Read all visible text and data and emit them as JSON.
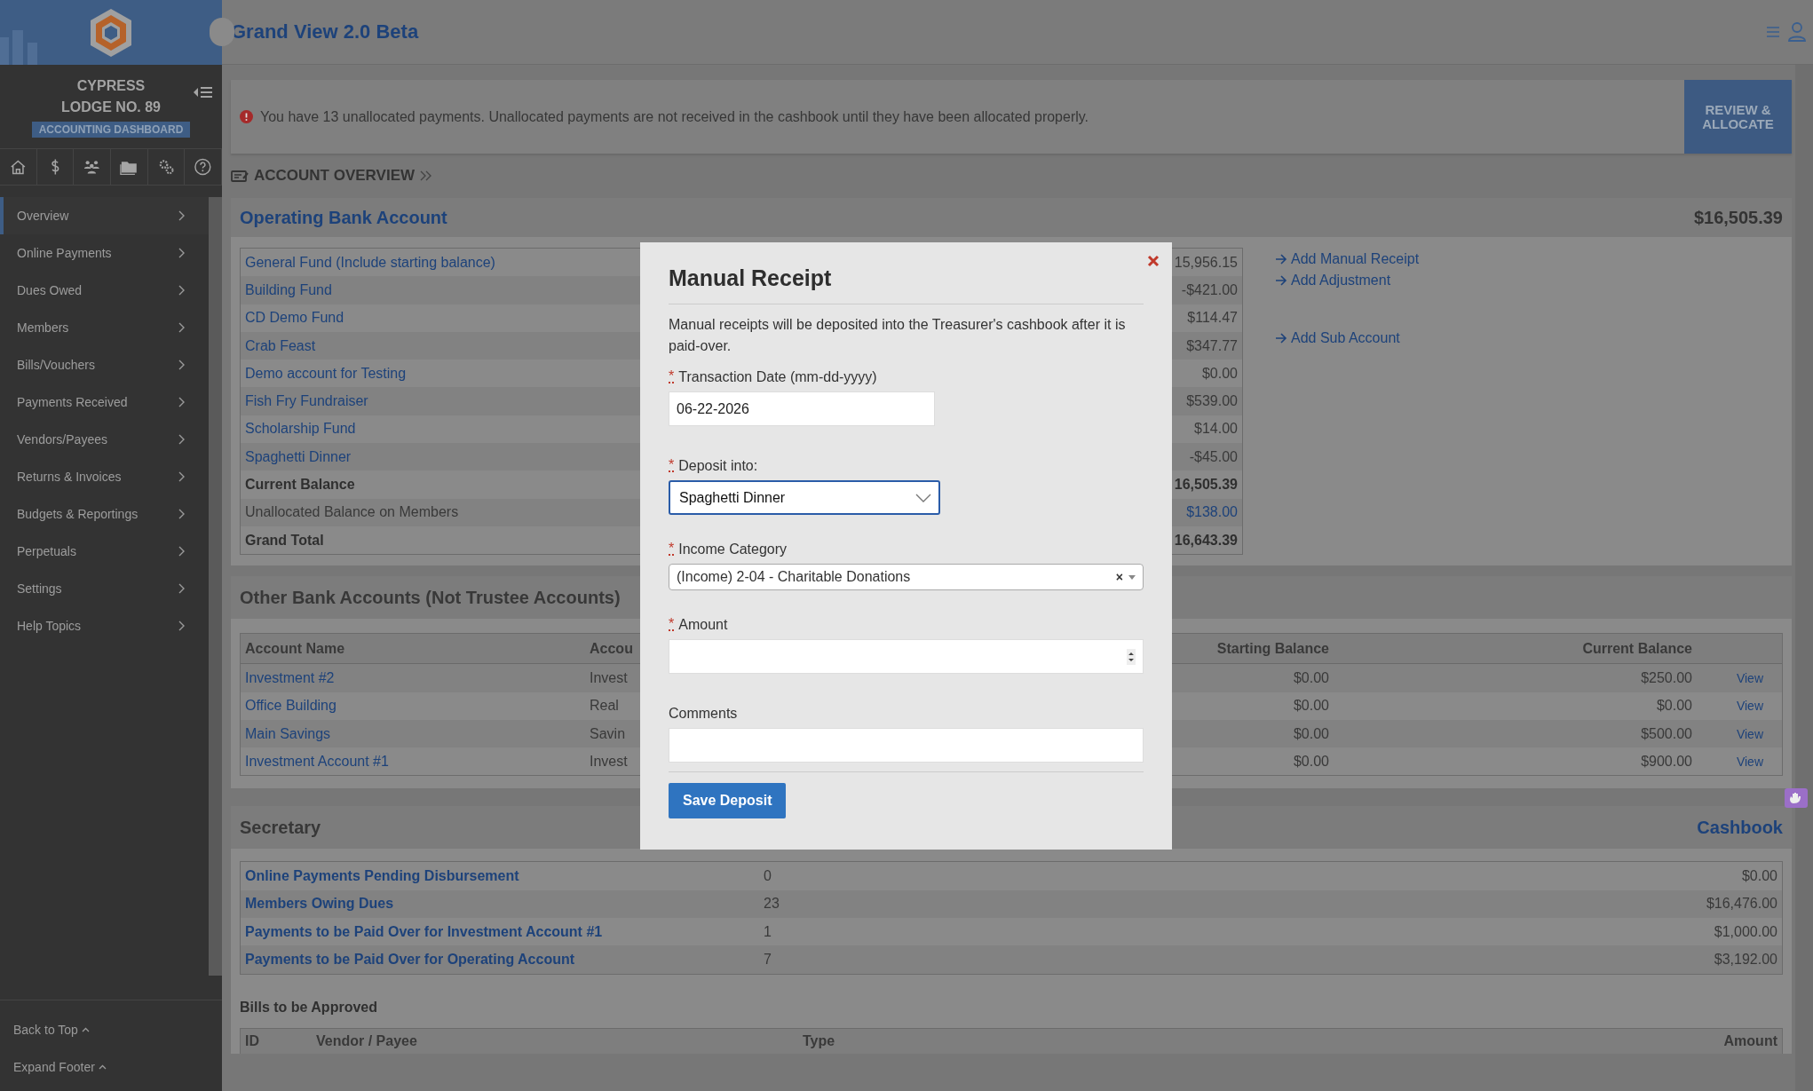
{
  "app": {
    "title": "Grand View 2.0 Beta"
  },
  "sidebar": {
    "org_name": [
      "CYPRESS",
      "LODGE NO. 89"
    ],
    "badge": "ACCOUNTING DASHBOARD",
    "nav": [
      {
        "label": "Overview",
        "selected": true
      },
      {
        "label": "Online Payments",
        "selected": false
      },
      {
        "label": "Dues Owed",
        "selected": false
      },
      {
        "label": "Members",
        "selected": false
      },
      {
        "label": "Bills/Vouchers",
        "selected": false
      },
      {
        "label": "Payments Received",
        "selected": false
      },
      {
        "label": "Vendors/Payees",
        "selected": false
      },
      {
        "label": "Returns & Invoices",
        "selected": false
      },
      {
        "label": "Budgets & Reportings",
        "selected": false
      },
      {
        "label": "Perpetuals",
        "selected": false
      },
      {
        "label": "Settings",
        "selected": false
      },
      {
        "label": "Help Topics",
        "selected": false
      }
    ],
    "footer_links": [
      "Back to Top",
      "Expand Footer"
    ]
  },
  "notice": {
    "text": "You have 13 unallocated payments. Unallocated payments are not received in the cashbook until they have been allocated properly.",
    "button": "REVIEW & ALLOCATE"
  },
  "section_heading": "ACCOUNT OVERVIEW",
  "operating": {
    "title": "Operating Bank Account",
    "total": "$16,505.39",
    "rows": [
      {
        "kind": "fund",
        "label": "General Fund (Include starting balance)",
        "value": "15,956.15"
      },
      {
        "kind": "fund",
        "label": "Building Fund",
        "value": "-$421.00"
      },
      {
        "kind": "fund",
        "label": "CD Demo Fund",
        "value": "$114.47"
      },
      {
        "kind": "fund",
        "label": "Crab Feast",
        "value": "$347.77"
      },
      {
        "kind": "fund",
        "label": "Demo account for Testing",
        "value": "$0.00"
      },
      {
        "kind": "fund",
        "label": "Fish Fry Fundraiser",
        "value": "$539.00"
      },
      {
        "kind": "fund",
        "label": "Scholarship Fund",
        "value": "$14.00"
      },
      {
        "kind": "fund",
        "label": "Spaghetti Dinner",
        "value": "-$45.00"
      },
      {
        "kind": "total",
        "label": "Current Balance",
        "value": "16,505.39"
      },
      {
        "kind": "unallocated",
        "label": "Unallocated Balance on Members",
        "value": "$138.00"
      },
      {
        "kind": "total",
        "label": "Grand Total",
        "value": "16,643.39"
      }
    ],
    "action_groups": [
      [
        "Add Manual Receipt",
        "Add Adjustment"
      ],
      [
        "Add Sub Account"
      ]
    ]
  },
  "other_accounts": {
    "title": "Other Bank Accounts (Not Trustee Accounts)",
    "columns": [
      "Account Name",
      "Accou",
      "Starting Balance",
      "Current Balance"
    ],
    "rows": [
      {
        "name": "Investment #2",
        "type": "Invest",
        "starting": "$0.00",
        "current": "$250.00",
        "action": "View"
      },
      {
        "name": "Office Building",
        "type": "Real",
        "starting": "$0.00",
        "current": "$0.00",
        "action": "View"
      },
      {
        "name": "Main Savings",
        "type": "Savin",
        "starting": "$0.00",
        "current": "$500.00",
        "action": "View"
      },
      {
        "name": "Investment Account #1",
        "type": "Invest",
        "starting": "$0.00",
        "current": "$900.00",
        "action": "View"
      }
    ]
  },
  "secretary": {
    "title": "Secretary",
    "link": "Cashbook",
    "rows": [
      {
        "label": "Online Payments Pending Disbursement",
        "count": "0",
        "amount": "$0.00"
      },
      {
        "label": "Members Owing Dues",
        "count": "23",
        "amount": "$16,476.00"
      },
      {
        "label": "Payments to be Paid Over for Investment Account #1",
        "count": "1",
        "amount": "$1,000.00"
      },
      {
        "label": "Payments to be Paid Over for Operating Account",
        "count": "7",
        "amount": "$3,192.00"
      }
    ]
  },
  "bills": {
    "title": "Bills to be Approved",
    "columns": [
      "ID",
      "Vendor / Payee",
      "Type",
      "Amount"
    ]
  },
  "modal": {
    "title": "Manual Receipt",
    "description": "Manual receipts will be deposited into the Treasurer's cashbook after it is paid-over.",
    "required_mark": "*",
    "fields": [
      {
        "kind": "date",
        "label": "Transaction Date (mm-dd-yyyy)",
        "required": true,
        "focused": false,
        "value": "06-22-2026"
      },
      {
        "kind": "select",
        "label": "Deposit into:",
        "required": true,
        "focused": true,
        "value": "Spaghetti Dinner"
      },
      {
        "kind": "combo",
        "label": "Income Category",
        "required": true,
        "focused": false,
        "value": "(Income) 2-04 - Charitable Donations",
        "clear_label": "×"
      },
      {
        "kind": "number",
        "label": "Amount",
        "required": true,
        "focused": false
      },
      {
        "kind": "text",
        "label": "Comments",
        "required": false,
        "focused": false
      }
    ],
    "button": "Save Deposit"
  }
}
